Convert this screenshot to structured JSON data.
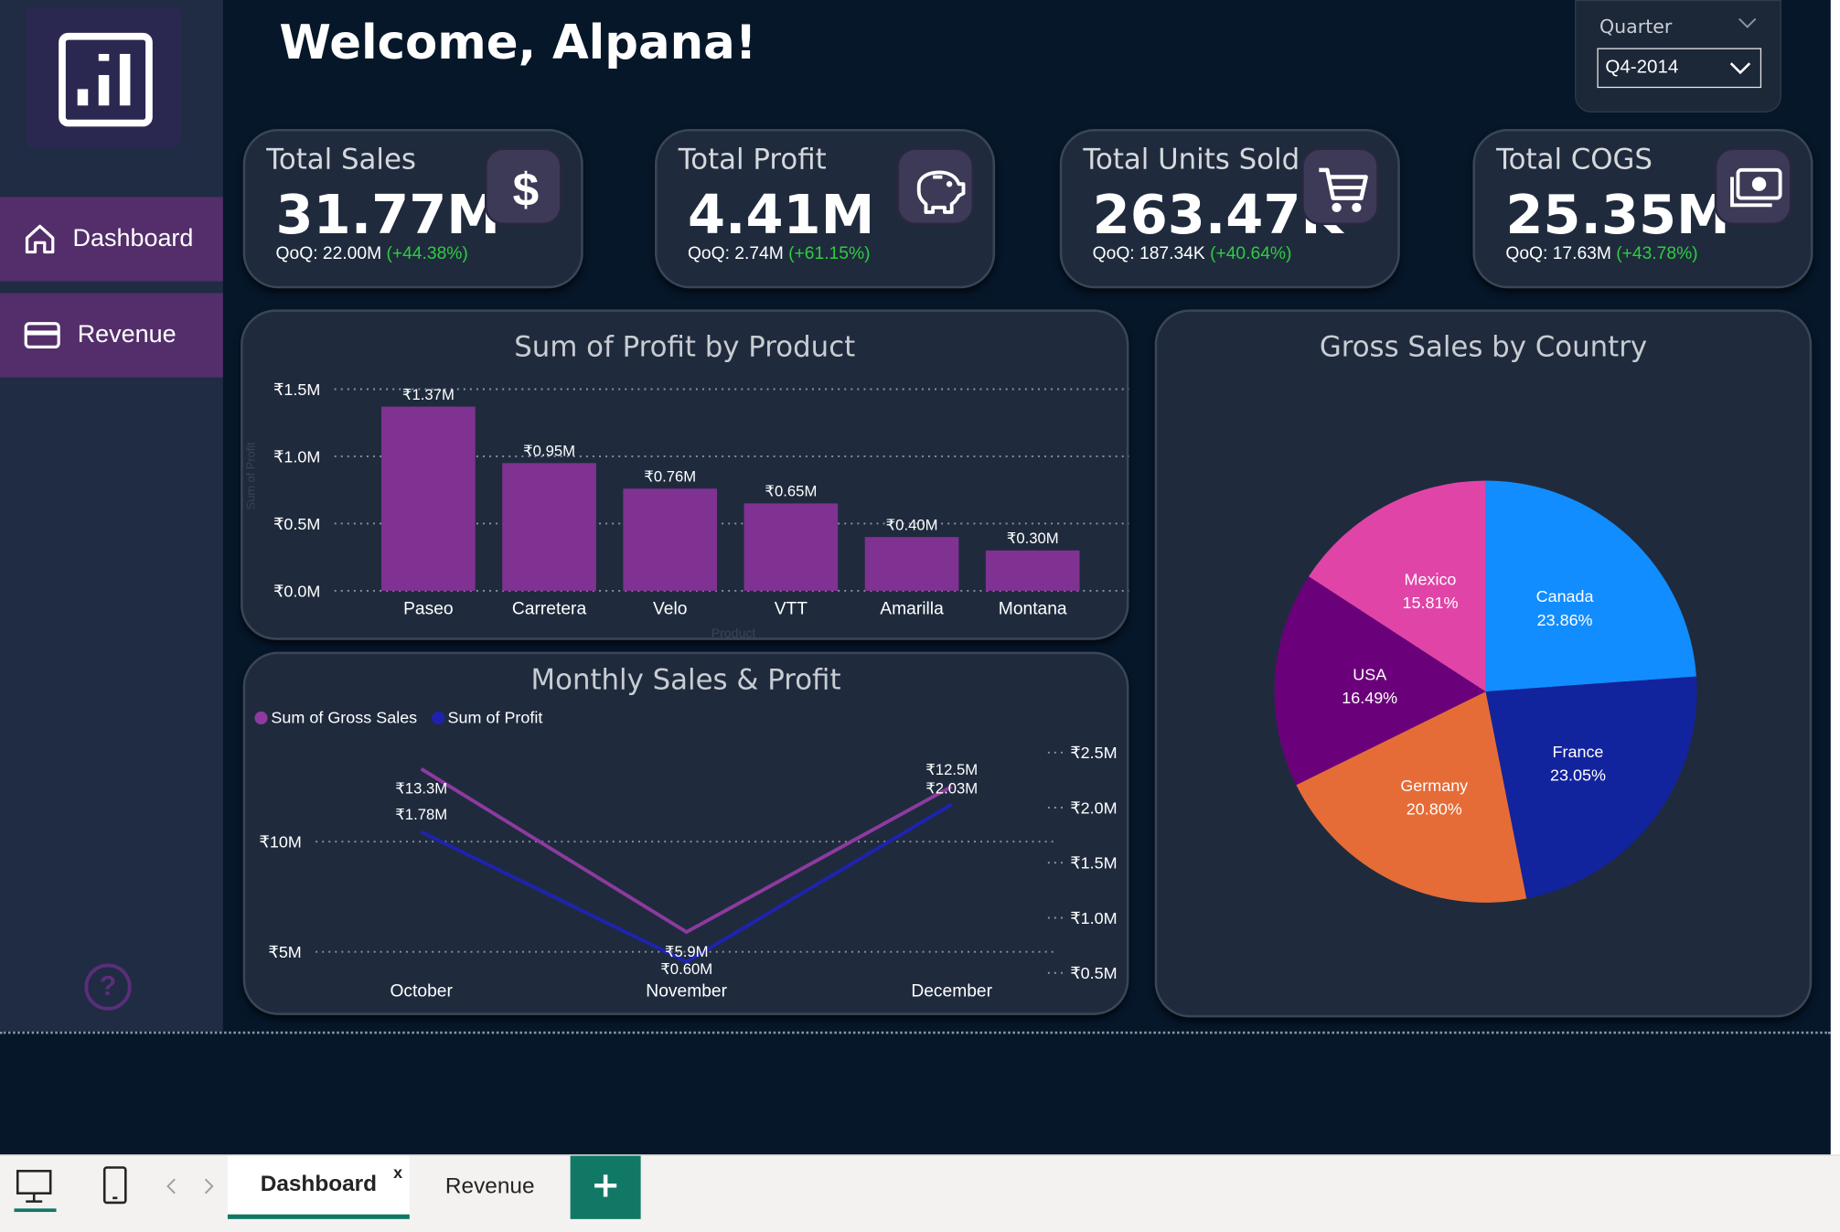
{
  "header": {
    "welcome": "Welcome, Alpana!"
  },
  "slicer": {
    "title": "Quarter",
    "value": "Q4-2014"
  },
  "nav": {
    "items": [
      {
        "label": "Dashboard",
        "icon": "home-icon"
      },
      {
        "label": "Revenue",
        "icon": "credit-card-icon"
      }
    ]
  },
  "kpis": [
    {
      "title": "Total Sales",
      "value": "31.77M",
      "qoq_base": "QoQ: 22.00M",
      "qoq_change": "(+44.38%)",
      "icon": "dollar-icon"
    },
    {
      "title": "Total Profit",
      "value": "4.41M",
      "qoq_base": "QoQ: 2.74M",
      "qoq_change": "(+61.15%)",
      "icon": "piggy-bank-icon"
    },
    {
      "title": "Total Units Sold",
      "value": "263.47K",
      "qoq_base": "QoQ: 187.34K",
      "qoq_change": "(+40.64%)",
      "icon": "shopping-cart-icon"
    },
    {
      "title": "Total COGS",
      "value": "25.35M",
      "qoq_base": "QoQ: 17.63M",
      "qoq_change": "(+43.78%)",
      "icon": "money-icon"
    }
  ],
  "colors": {
    "canvas": "#06172a",
    "sidebar": "#1f2c43",
    "nav_active": "#532e6a",
    "panel": "#1f2b3d",
    "bar": "#7f3291",
    "positive": "#2ecc40",
    "gross_sales_line": "#8e3aa0",
    "profit_line": "#1f22b0"
  },
  "charts": {
    "profit_by_product": {
      "title": "Sum of Profit by Product",
      "xlabel": "Product",
      "ylabel": "Sum of Profit"
    },
    "monthly": {
      "title": "Monthly Sales & Profit",
      "legend": [
        "Sum of  Gross Sales",
        "Sum of  Profit"
      ]
    },
    "country": {
      "title": "Gross Sales by Country"
    }
  },
  "chart_data": [
    {
      "type": "bar",
      "title": "Sum of Profit by Product",
      "xlabel": "Product",
      "ylabel": "Sum of Profit",
      "categories": [
        "Paseo",
        "Carretera",
        "Velo",
        "VTT",
        "Amarilla",
        "Montana"
      ],
      "values": [
        1.37,
        0.95,
        0.76,
        0.65,
        0.4,
        0.3
      ],
      "data_labels": [
        "₹1.37M",
        "₹0.95M",
        "₹0.76M",
        "₹0.65M",
        "₹0.40M",
        "₹0.30M"
      ],
      "unit": "₹ millions",
      "ylim": [
        0,
        1.5
      ],
      "yticks": [
        "₹0.0M",
        "₹0.5M",
        "₹1.0M",
        "₹1.5M"
      ],
      "grid": true
    },
    {
      "type": "line",
      "title": "Monthly Sales & Profit",
      "categories": [
        "October",
        "November",
        "December"
      ],
      "series": [
        {
          "name": "Sum of  Gross Sales",
          "axis": "left",
          "values": [
            13.3,
            5.9,
            12.5
          ],
          "labels": [
            "₹13.3M",
            "₹5.9M",
            "₹12.5M"
          ]
        },
        {
          "name": "Sum of  Profit",
          "axis": "right",
          "values": [
            1.78,
            0.6,
            2.03
          ],
          "labels": [
            "₹1.78M",
            "₹0.60M",
            "₹2.03M"
          ]
        }
      ],
      "left_ticks": [
        "₹5M",
        "₹10M"
      ],
      "right_ticks": [
        "₹0.5M",
        "₹1.0M",
        "₹1.5M",
        "₹2.0M",
        "₹2.5M"
      ],
      "legend": "top-left"
    },
    {
      "type": "pie",
      "title": "Gross Sales by Country",
      "slices": [
        {
          "label": "Canada",
          "value": 23.86,
          "text": "23.86%",
          "color": "#118dff"
        },
        {
          "label": "France",
          "value": 23.05,
          "text": "23.05%",
          "color": "#12239e"
        },
        {
          "label": "Germany",
          "value": 20.8,
          "text": "20.80%",
          "color": "#e66c37"
        },
        {
          "label": "USA",
          "value": 16.49,
          "text": "16.49%",
          "color": "#6b007b"
        },
        {
          "label": "Mexico",
          "value": 15.81,
          "text": "15.81%",
          "color": "#e044a7"
        }
      ]
    }
  ],
  "tabs": {
    "items": [
      {
        "label": "Dashboard",
        "close": "x"
      },
      {
        "label": "Revenue"
      }
    ],
    "add": "+"
  }
}
